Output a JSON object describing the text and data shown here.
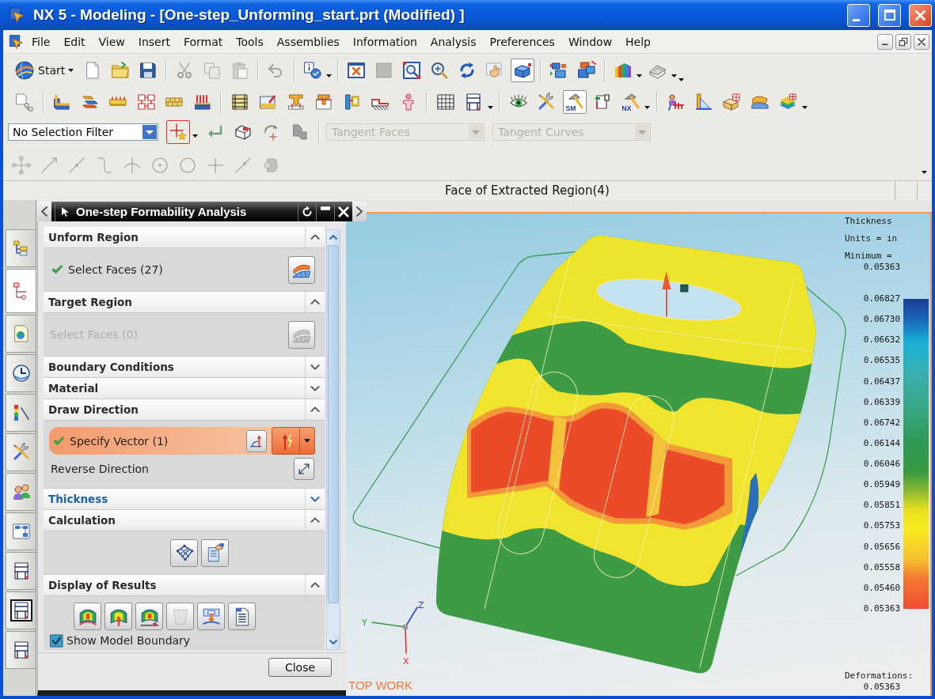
{
  "window": {
    "title": "NX 5 - Modeling - [One-step_Unforming_start.prt (Modified) ]"
  },
  "menu": [
    "File",
    "Edit",
    "View",
    "Insert",
    "Format",
    "Tools",
    "Assemblies",
    "Information",
    "Analysis",
    "Preferences",
    "Window",
    "Help"
  ],
  "toolbars": [
    {
      "start_label": "Start",
      "items": [
        {
          "pressed": false,
          "disabled": false
        },
        {
          "pressed": false,
          "disabled": false
        },
        {
          "pressed": false,
          "disabled": false
        },
        {
          "pressed": false,
          "disabled": true
        },
        {
          "pressed": false,
          "disabled": true
        },
        {
          "pressed": false,
          "disabled": true
        },
        {
          "pressed": false,
          "disabled": true
        },
        {
          "pressed": false,
          "disabled": false
        },
        {
          "pressed": false,
          "disabled": false
        },
        {
          "pressed": false,
          "disabled": true
        },
        {
          "pressed": false,
          "disabled": false
        },
        {
          "pressed": false,
          "disabled": false
        },
        {
          "pressed": false,
          "disabled": false
        },
        {
          "pressed": false,
          "disabled": false
        },
        {
          "pressed": true,
          "disabled": false
        },
        {
          "pressed": false,
          "disabled": false
        },
        {
          "pressed": false,
          "disabled": false
        },
        {
          "pressed": false,
          "disabled": false
        },
        {
          "pressed": false,
          "disabled": false
        }
      ]
    },
    {
      "items": [
        {
          "pressed": false
        },
        {
          "pressed": false
        },
        {
          "pressed": false
        },
        {
          "pressed": false
        },
        {
          "pressed": false
        },
        {
          "pressed": false
        },
        {
          "pressed": false
        },
        {
          "pressed": false
        },
        {
          "pressed": false
        },
        {
          "pressed": false
        },
        {
          "pressed": false
        },
        {
          "pressed": false
        },
        {
          "pressed": false
        },
        {
          "pressed": false
        },
        {
          "pressed": false
        },
        {
          "pressed": false
        },
        {
          "pressed": false
        },
        {
          "pressed": false
        },
        {
          "pressed": true,
          "badge": "SM"
        },
        {
          "pressed": false
        },
        {
          "pressed": false,
          "badge": "NX"
        },
        {
          "pressed": false
        },
        {
          "pressed": false
        },
        {
          "pressed": false
        },
        {
          "pressed": false
        },
        {
          "pressed": false
        }
      ]
    }
  ],
  "selection_bar": {
    "filter": "No Selection Filter",
    "face_rule": {
      "value": "Tangent Faces",
      "disabled": true
    },
    "curve_rule": {
      "value": "Tangent Curves",
      "disabled": true
    }
  },
  "snap_bar": {
    "items": [
      {
        "disabled": true
      },
      {
        "disabled": true
      },
      {
        "disabled": true
      },
      {
        "disabled": true
      },
      {
        "disabled": true
      },
      {
        "disabled": true
      },
      {
        "disabled": true
      },
      {
        "disabled": true
      },
      {
        "disabled": true
      },
      {
        "disabled": true
      }
    ]
  },
  "status_line": {
    "text": "Face of Extracted Region(4)"
  },
  "resource_bar": {
    "tabs": [
      {
        "selected": false,
        "highlighted": false
      },
      {
        "selected": true,
        "highlighted": false
      },
      {
        "selected": false,
        "highlighted": false
      },
      {
        "selected": false,
        "highlighted": false
      },
      {
        "selected": false,
        "highlighted": false
      },
      {
        "selected": false,
        "highlighted": false
      },
      {
        "selected": false,
        "highlighted": false
      },
      {
        "selected": false,
        "highlighted": false
      },
      {
        "selected": false,
        "highlighted": false
      },
      {
        "selected": false,
        "highlighted": true
      },
      {
        "selected": false,
        "highlighted": false
      }
    ]
  },
  "dialog": {
    "title": "One-step Formability Analysis",
    "sections": [
      {
        "title": "Unform Region",
        "expanded": true,
        "highlighted": false,
        "rows": [
          {
            "kind": "select",
            "label": "Select Faces (27)",
            "complete": true,
            "disabled": false
          }
        ]
      },
      {
        "title": "Target Region",
        "expanded": true,
        "highlighted": false,
        "rows": [
          {
            "kind": "select",
            "label": "Select Faces (0)",
            "complete": false,
            "disabled": true
          }
        ]
      },
      {
        "title": "Boundary Conditions",
        "expanded": false,
        "highlighted": false
      },
      {
        "title": "Material",
        "expanded": false,
        "highlighted": false
      },
      {
        "title": "Draw Direction",
        "expanded": true,
        "highlighted": false,
        "rows": [
          {
            "kind": "vector",
            "label": "Specify Vector (1)",
            "complete": true,
            "active": true
          },
          {
            "kind": "action",
            "label": "Reverse Direction"
          }
        ]
      },
      {
        "title": "Thickness",
        "expanded": false,
        "highlighted": true
      },
      {
        "title": "Calculation",
        "expanded": true,
        "highlighted": false,
        "rows": [
          {
            "kind": "buttons",
            "buttons": [
              {
                "disabled": false
              },
              {
                "disabled": false
              }
            ]
          }
        ]
      },
      {
        "title": "Display of Results",
        "expanded": true,
        "highlighted": false,
        "rows": [
          {
            "kind": "buttons",
            "buttons": [
              {
                "disabled": false
              },
              {
                "disabled": false
              },
              {
                "disabled": false
              },
              {
                "disabled": true
              },
              {
                "disabled": false
              },
              {
                "disabled": false
              }
            ]
          },
          {
            "kind": "checkbox",
            "label": "Show Model Boundary",
            "checked": true
          }
        ]
      }
    ],
    "close_label": "Close"
  },
  "viewport": {
    "view_label": "TOP WORK",
    "axes": {
      "x": "X",
      "y": "Y",
      "z": "Z"
    },
    "legend": {
      "title": "Thickness",
      "units": "Units = in",
      "minimum_label": "Minimum =",
      "minimum_value": "0.05363",
      "scale_labels": [
        "0.06827",
        "0.06730",
        "0.06632",
        "0.06535",
        "0.06437",
        "0.06339",
        "0.06742",
        "0.06144",
        "0.06046",
        "0.05949",
        "0.05851",
        "0.05753",
        "0.05656",
        "0.05558",
        "0.05460",
        "0.05363"
      ],
      "footer_label": "Deformations:",
      "footer_value": "0.05363"
    }
  }
}
